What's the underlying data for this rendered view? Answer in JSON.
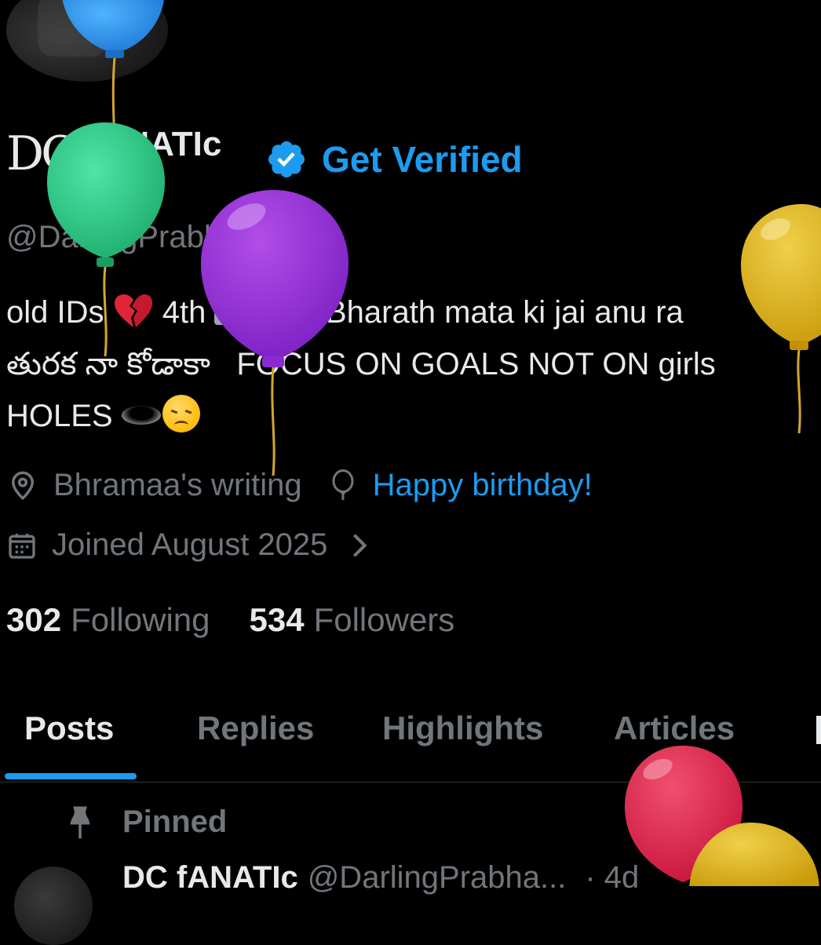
{
  "profile": {
    "logo_text": "DC",
    "name": "fANATIc",
    "get_verified_label": "Get Verified",
    "handle": "@DarlingPrabha_7",
    "bio_line1_a": "old IDs",
    "bio_line1_b": "4th",
    "bio_line1_c": "I'd",
    "bio_line1_d": "Bharath mata ki jai anu ra",
    "bio_line2_a": "తురక నా కోడాకా",
    "bio_line2_b": "FOCUS ON GOALS NOT ON girls",
    "bio_line3": "HOLES",
    "location": "Bhramaa's writing",
    "birthday_link": "Happy birthday!",
    "joined": "Joined August 2025",
    "following_count": "302",
    "following_label": "Following",
    "followers_count": "534",
    "followers_label": "Followers"
  },
  "tabs": [
    {
      "label": "Posts",
      "active": true
    },
    {
      "label": "Replies"
    },
    {
      "label": "Highlights"
    },
    {
      "label": "Articles"
    }
  ],
  "pinned": {
    "label": "Pinned",
    "post_name": "DC fANATIc",
    "post_handle": "@DarlingPrabha...",
    "post_time": "· 4d"
  },
  "icons": {
    "verified": "verified-badge-icon",
    "location": "location-pin-icon",
    "birthday": "balloon-icon",
    "calendar": "calendar-icon",
    "chevron": "chevron-right-icon",
    "pin": "pin-icon"
  },
  "colors": {
    "background": "#000000",
    "text_primary": "#e7e9ea",
    "text_secondary": "#71767b",
    "accent": "#1d9bf0"
  }
}
